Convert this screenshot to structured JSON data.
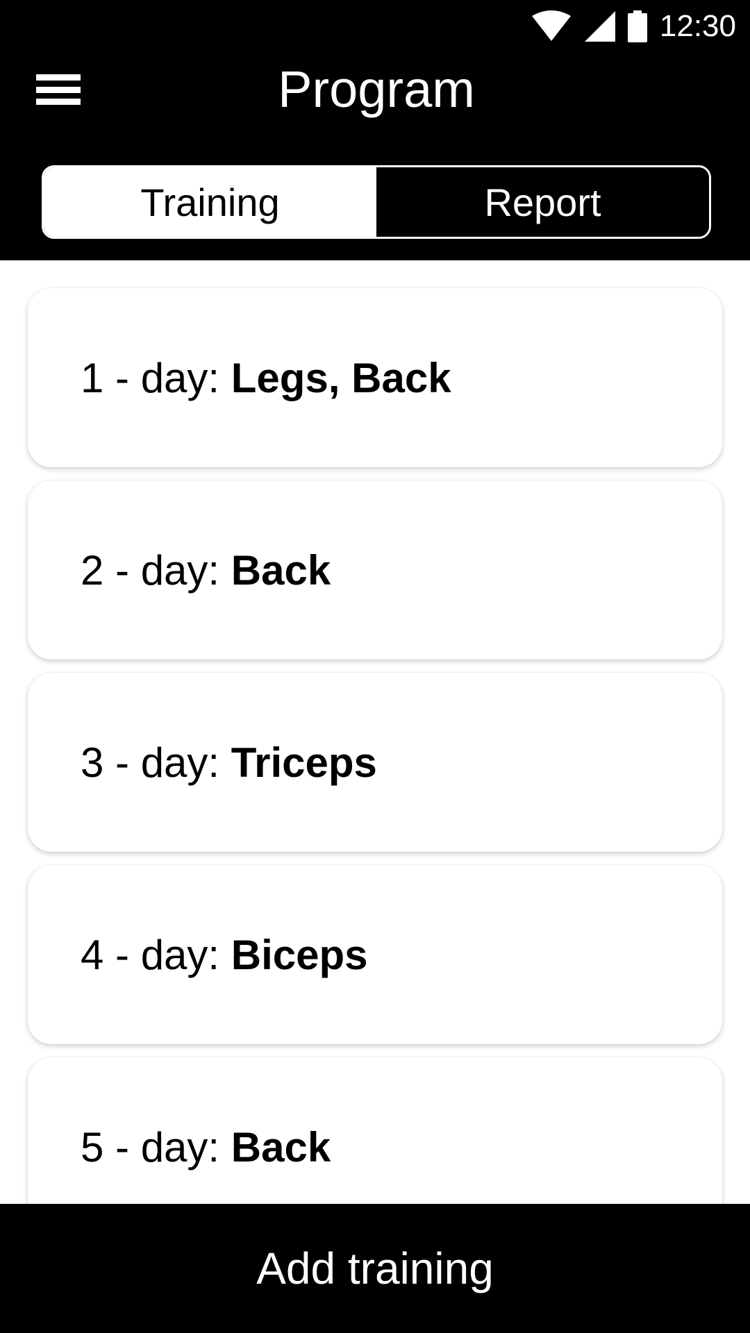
{
  "status_bar": {
    "time": "12:30",
    "icons": [
      "wifi-icon",
      "cell-signal-icon",
      "battery-icon"
    ]
  },
  "app_bar": {
    "title": "Program",
    "menu_icon": "hamburger-menu-icon"
  },
  "tabs": [
    {
      "label": "Training",
      "active": true
    },
    {
      "label": "Report",
      "active": false
    }
  ],
  "trainings": [
    {
      "prefix": "1 - day: ",
      "muscles": "Legs, Back"
    },
    {
      "prefix": "2 - day: ",
      "muscles": "Back"
    },
    {
      "prefix": "3 - day: ",
      "muscles": "Triceps"
    },
    {
      "prefix": "4 - day: ",
      "muscles": "Biceps"
    },
    {
      "prefix": "5 - day: ",
      "muscles": "Back"
    }
  ],
  "add_button": {
    "label": "Add training"
  },
  "colors": {
    "primary": "#000000",
    "surface": "#ffffff"
  }
}
